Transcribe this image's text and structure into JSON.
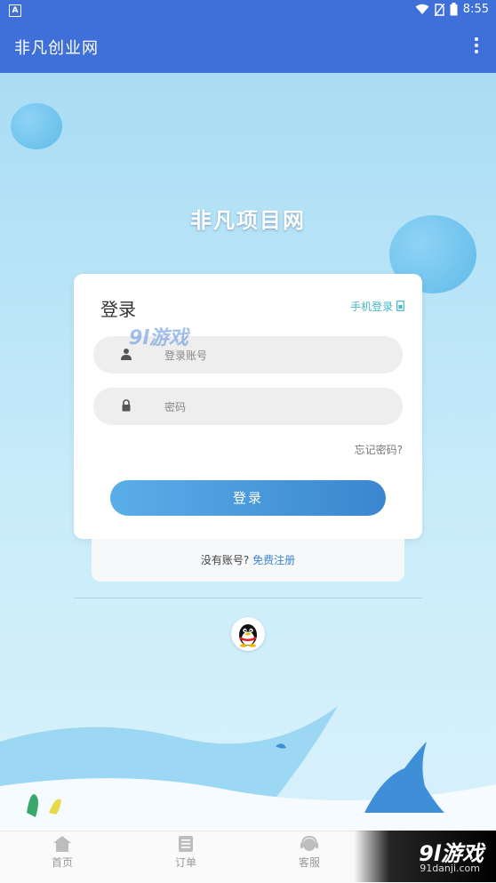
{
  "status_bar": {
    "time": "8:55",
    "app_badge": "A"
  },
  "app_bar": {
    "title": "非凡创业网"
  },
  "headline": "非凡项目网",
  "login_card": {
    "title": "登录",
    "phone_login": "手机登录",
    "account_placeholder": "登录账号",
    "password_placeholder": "密码",
    "forgot_password": "忘记密码?",
    "login_button": "登录"
  },
  "register": {
    "prompt": "没有账号?",
    "link": "免费注册"
  },
  "watermark": {
    "brand": "9l游戏",
    "site": "91danji.com"
  },
  "bottom_nav": [
    {
      "label": "首页",
      "icon": "home-icon"
    },
    {
      "label": "订单",
      "icon": "order-icon"
    },
    {
      "label": "客服",
      "icon": "customer-service-icon"
    }
  ],
  "colors": {
    "primary": "#3f6fd9",
    "accent": "#44b8c7",
    "button_gradient": [
      "#5aaee8",
      "#3b86cf"
    ]
  }
}
